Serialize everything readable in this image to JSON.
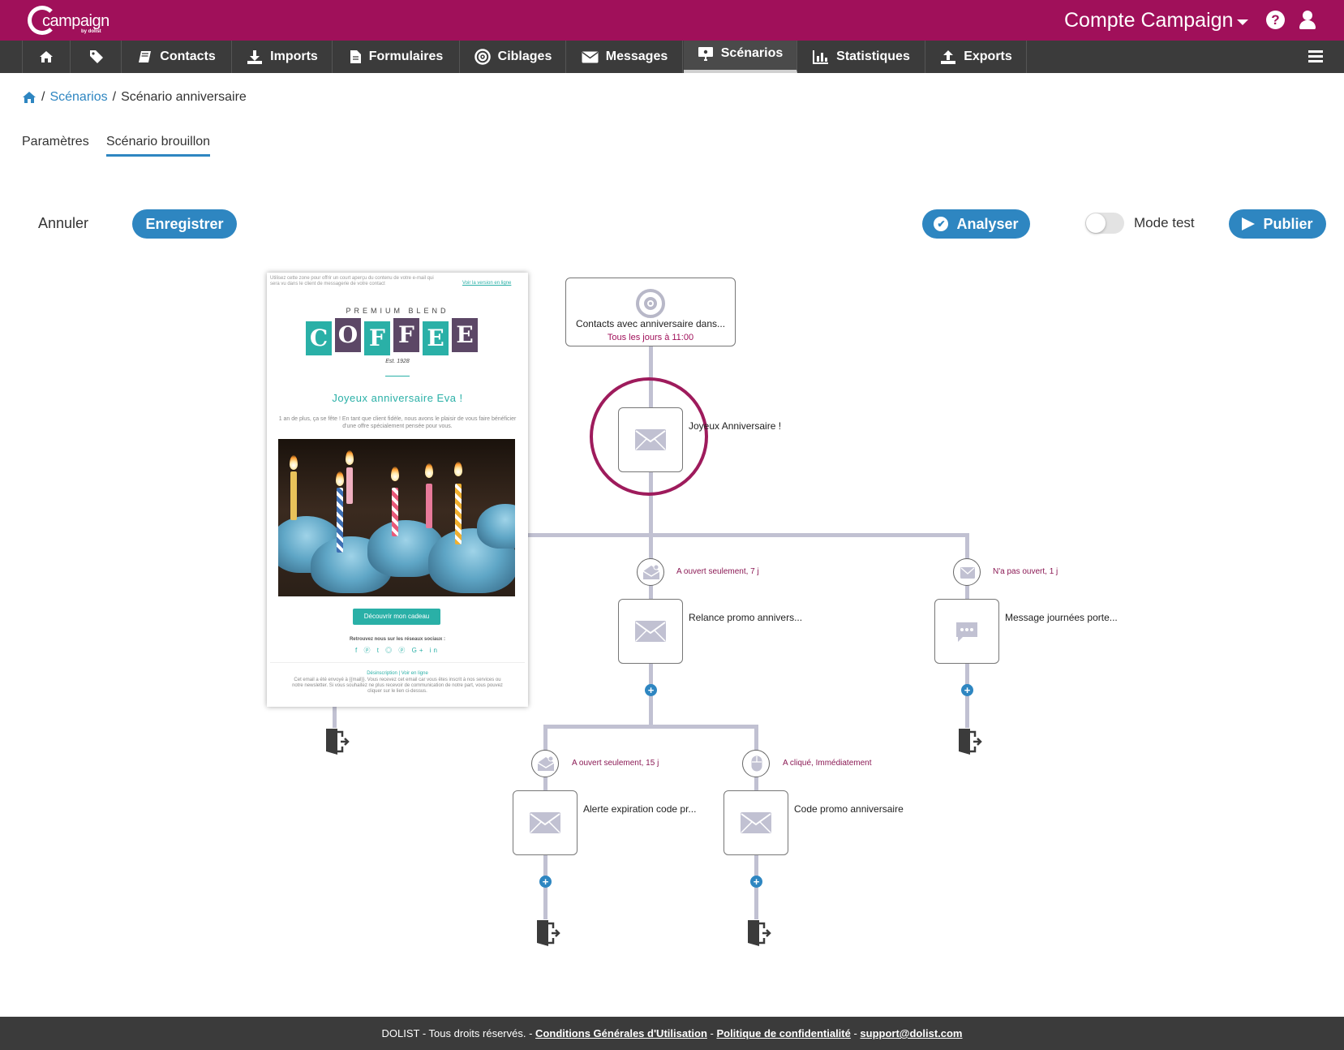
{
  "header": {
    "logo_text": "campaign",
    "logo_sub": "by dolist",
    "account": "Compte Campaign",
    "help_icon": "question-circle-icon",
    "user_icon": "user-icon",
    "brand_color": "#a0105a"
  },
  "nav": {
    "items": [
      {
        "label": "",
        "icon": "home-icon"
      },
      {
        "label": "",
        "icon": "tag-icon"
      },
      {
        "label": "Contacts",
        "icon": "book-icon"
      },
      {
        "label": "Imports",
        "icon": "download-icon"
      },
      {
        "label": "Formulaires",
        "icon": "file-icon"
      },
      {
        "label": "Ciblages",
        "icon": "target-icon"
      },
      {
        "label": "Messages",
        "icon": "envelope-icon"
      },
      {
        "label": "Scénarios",
        "icon": "sitemap-icon",
        "active": true
      },
      {
        "label": "Statistiques",
        "icon": "chart-icon"
      },
      {
        "label": "Exports",
        "icon": "upload-icon"
      }
    ],
    "menu_icon": "hamburger-icon"
  },
  "breadcrumb": {
    "home_icon": "home-icon",
    "link": "Scénarios",
    "current": "Scénario anniversaire"
  },
  "tabs": {
    "params": "Paramètres",
    "draft": "Scénario brouillon"
  },
  "actions": {
    "cancel": "Annuler",
    "save": "Enregistrer",
    "analyze": "Analyser",
    "mode_test": "Mode test",
    "mode_test_on": false,
    "publish": "Publier",
    "accent": "#2e86c1"
  },
  "flow": {
    "trigger": {
      "title": "Contacts avec anniversaire dans...",
      "schedule": "Tous les jours à 11:00"
    },
    "root_message": "Joyeux Anniversaire !",
    "branch_left": {
      "condition": "A ouvert seulement,  7 j",
      "message": "Relance promo annivers..."
    },
    "branch_right": {
      "condition": "N'a pas ouvert,  1 j",
      "message": "Message journées porte..."
    },
    "sub_left": {
      "condition": "A ouvert seulement,  15 j",
      "message": "Alerte expiration code pr..."
    },
    "sub_right": {
      "condition": "A cliqué,  Immédiatement",
      "message": "Code promo anniversaire"
    }
  },
  "preview": {
    "preheader": "Utilisez cette zone pour offrir un court aperçu du contenu de votre e-mail qui sera vu dans le client de messagerie de votre contact",
    "online_link": "Voir la version en ligne",
    "blend": "PREMIUM BLEND",
    "letters": [
      "C",
      "O",
      "F",
      "F",
      "E",
      "E"
    ],
    "est": "Est. 1928",
    "title": "Joyeux anniversaire Eva !",
    "text": "1 an de plus, ça se fête ! En tant que client fidèle, nous avons le plaisir de vous faire bénéficier d'une offre spécialement pensée pour vous.",
    "button": "Découvrir mon cadeau",
    "social_title": "Retrouvez nous sur les réseaux sociaux :",
    "social_icons": "f ⓟ t ◎ ⓟ G+ in",
    "unsub": "Désinscription  |  Voir en ligne",
    "footer": "Cet email a été envoyé à {{mail}}. Vous recevez cet email car vous êtes inscrit à nos services ou notre newsletter. Si vous souhaitez ne plus recevoir de communication de notre part, vous pouvez cliquer sur le lien ci-dessus."
  },
  "footer": {
    "copyright": "DOLIST - Tous droits réservés. -",
    "cgu": "Conditions Générales d'Utilisation",
    "sep1": " - ",
    "privacy": "Politique de confidentialité",
    "sep2": " - ",
    "support": "support@dolist.com"
  }
}
